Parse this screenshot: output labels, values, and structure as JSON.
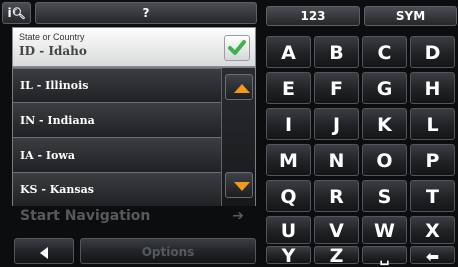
{
  "toolbar": {
    "search_label": "i",
    "help_label": "?",
    "numeric_label": "123",
    "symbol_label": "SYM"
  },
  "input": {
    "label": "State or Country",
    "value": "ID - Idaho",
    "confirm_icon": "checkmark-icon"
  },
  "suggestions": [
    {
      "label": "IL - Illinois"
    },
    {
      "label": "IN - Indiana"
    },
    {
      "label": "IA - Iowa"
    },
    {
      "label": "KS - Kansas"
    }
  ],
  "background": {
    "start_navigation": "Start Navigation",
    "options": "Options"
  },
  "keyboard": {
    "rows": [
      [
        "A",
        "B",
        "C",
        "D"
      ],
      [
        "E",
        "F",
        "G",
        "H"
      ],
      [
        "I",
        "J",
        "K",
        "L"
      ],
      [
        "M",
        "N",
        "O",
        "P"
      ],
      [
        "Q",
        "R",
        "S",
        "T"
      ],
      [
        "U",
        "V",
        "W",
        "X"
      ],
      [
        "Y",
        "Z",
        "␣",
        "⬅"
      ]
    ],
    "space_icon": "space-icon",
    "backspace_icon": "backspace-icon"
  },
  "colors": {
    "accent": "#f39a1a",
    "confirm": "#3bb34a"
  }
}
